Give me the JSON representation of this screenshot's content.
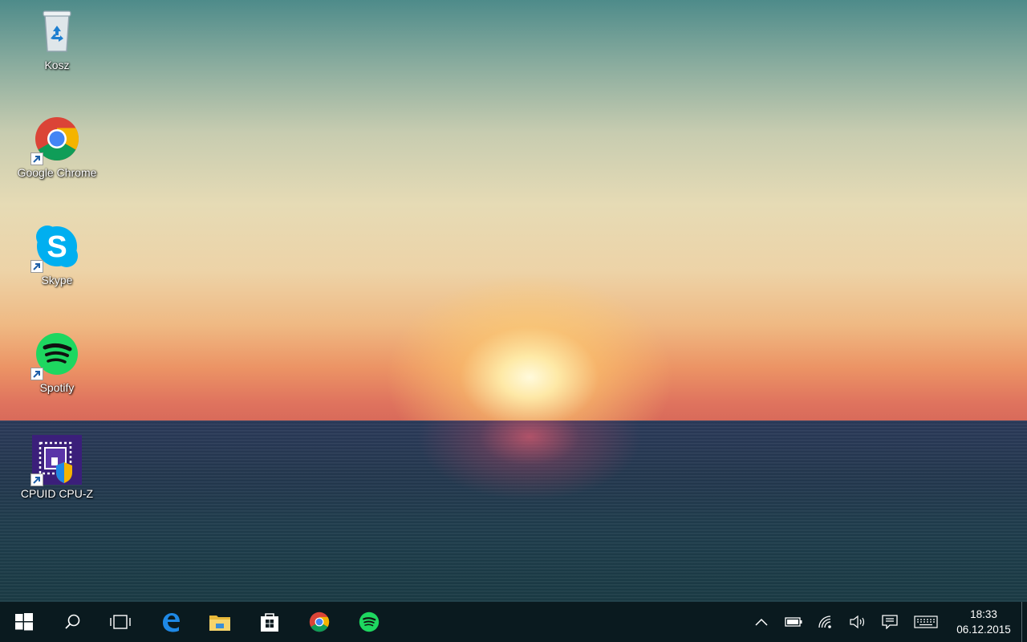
{
  "desktop": {
    "icons": [
      {
        "label": "Kosz",
        "icon": "recycle-bin-icon"
      },
      {
        "label": "Google Chrome",
        "icon": "chrome-icon"
      },
      {
        "label": "Skype",
        "icon": "skype-icon"
      },
      {
        "label": "Spotify",
        "icon": "spotify-icon"
      },
      {
        "label": "CPUID CPU-Z",
        "icon": "cpu-z-icon"
      }
    ]
  },
  "taskbar": {
    "buttons": [
      "start-icon",
      "search-icon",
      "task-view-icon",
      "edge-icon",
      "file-explorer-icon",
      "store-icon",
      "chrome-icon",
      "spotify-icon"
    ],
    "tray": [
      "chevron-up-icon",
      "battery-icon",
      "wifi-icon",
      "volume-icon",
      "action-center-icon",
      "keyboard-icon"
    ],
    "clock": {
      "time": "18:33",
      "date": "06.12.2015"
    }
  },
  "colors": {
    "taskbar": "#0a1a1f",
    "chrome_red": "#db4437",
    "chrome_yellow": "#f4b400",
    "chrome_green": "#0f9d58",
    "chrome_blue": "#4285f4",
    "skype_blue": "#00aff0",
    "spotify_green": "#1ed760",
    "edge_blue": "#1e88e5"
  }
}
